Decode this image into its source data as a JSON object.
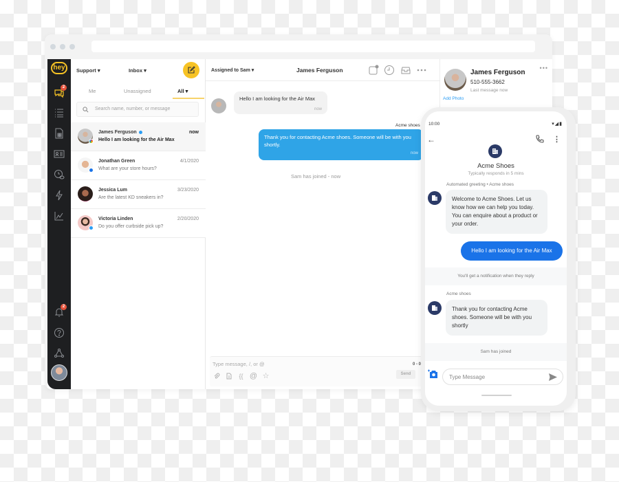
{
  "window": {
    "url": ""
  },
  "nav": {
    "logo": "hey",
    "items": [
      {
        "name": "conversations",
        "badge": "2"
      },
      {
        "name": "list"
      },
      {
        "name": "forms"
      },
      {
        "name": "contacts"
      },
      {
        "name": "scheduled"
      },
      {
        "name": "automations"
      },
      {
        "name": "reports"
      }
    ],
    "bottom": [
      {
        "name": "notifications",
        "badge": "2"
      },
      {
        "name": "help"
      },
      {
        "name": "integrations"
      },
      {
        "name": "user-avatar"
      }
    ]
  },
  "convlist": {
    "team_dropdown": "Support ▾",
    "folder_dropdown": "Inbox ▾",
    "tabs": [
      {
        "label": "Me"
      },
      {
        "label": "Unassigned"
      },
      {
        "label": "All ▾",
        "active": true
      }
    ],
    "search_placeholder": "Search name, number, or message",
    "conversations": [
      {
        "name": "James Ferguson",
        "message": "Hello I am looking for the Air Max",
        "date": "now",
        "source": "google",
        "verified": true,
        "selected": true
      },
      {
        "name": "Jonathan Green",
        "message": "What are your store hours?",
        "date": "4/1/2020",
        "source": "sms"
      },
      {
        "name": "Jessica Lum",
        "message": "Are the latest KD sneakers in?",
        "date": "3/23/2020",
        "source": "none"
      },
      {
        "name": "Victoria Linden",
        "message": "Do you offer curbside pick up?",
        "date": "2/20/2020",
        "source": "messenger"
      }
    ]
  },
  "chat": {
    "assigned": "Assigned to Sam ▾",
    "title": "James Ferguson",
    "messages": [
      {
        "direction": "in",
        "text": "Hello I am looking for the Air Max",
        "time": "now"
      },
      {
        "direction": "out",
        "sender": "Acme shoes",
        "text": "Thank you for contacting Acme shoes. Someone will be with you shortly.",
        "time": "now"
      }
    ],
    "system": "Sam has joined - now",
    "composer": {
      "placeholder": "Type message, /, or @",
      "counter": "0 - 0",
      "send_label": "Send"
    }
  },
  "contact": {
    "name": "James Ferguson",
    "phone": "510-555-3662",
    "last_message": "Last message now",
    "add_photo": "Add Photo"
  },
  "phone": {
    "status_time": "10:00",
    "business_name": "Acme Shoes",
    "business_sub": "Typically responds in 5 mins",
    "greeting_label": "Automated greeting • Acme shoes",
    "greeting_text": "Welcome to Acme Shoes. Let us know how we can help you today. You can enquire about a product or your order.",
    "user_message": "Hello I am looking for the Air Max",
    "notification_banner": "You'll get a notification when they reply",
    "reply_label": "Acme shoes",
    "reply_text": "Thank you for contacting Acme shoes. Someone will be with you shortly",
    "joined_banner": "Sam has joined",
    "input_placeholder": "Type Message"
  },
  "colors": {
    "brand_yellow": "#f7c325",
    "nav_dark": "#1e1f21",
    "outgoing_blue": "#2fa4e7",
    "phone_outgoing_blue": "#1a73e8",
    "business_navy": "#2b3a67",
    "badge_red": "#e5533c"
  }
}
